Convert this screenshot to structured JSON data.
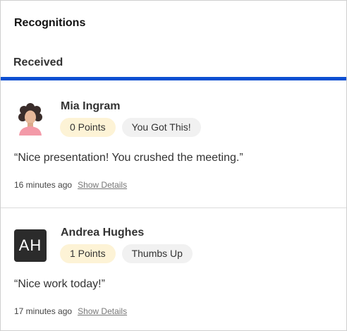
{
  "header": {
    "title": "Recognitions"
  },
  "tabs": {
    "received_label": "Received"
  },
  "colors": {
    "tab_indicator": "#0b4fd1",
    "points_chip": "#fdf3d6",
    "badge_chip": "#f1f1f1"
  },
  "recognitions": [
    {
      "sender": "Mia Ingram",
      "avatar": "woman-avatar-icon",
      "points": "0 Points",
      "badge": "You Got This!",
      "message": "“Nice presentation! You crushed the meeting.”",
      "time": "16 minutes ago",
      "details_link": "Show Details"
    },
    {
      "sender": "Andrea Hughes",
      "avatar_initials": "AH",
      "points": "1 Points",
      "badge": "Thumbs Up",
      "message": "“Nice work today!”",
      "time": "17 minutes ago",
      "details_link": "Show Details"
    }
  ]
}
